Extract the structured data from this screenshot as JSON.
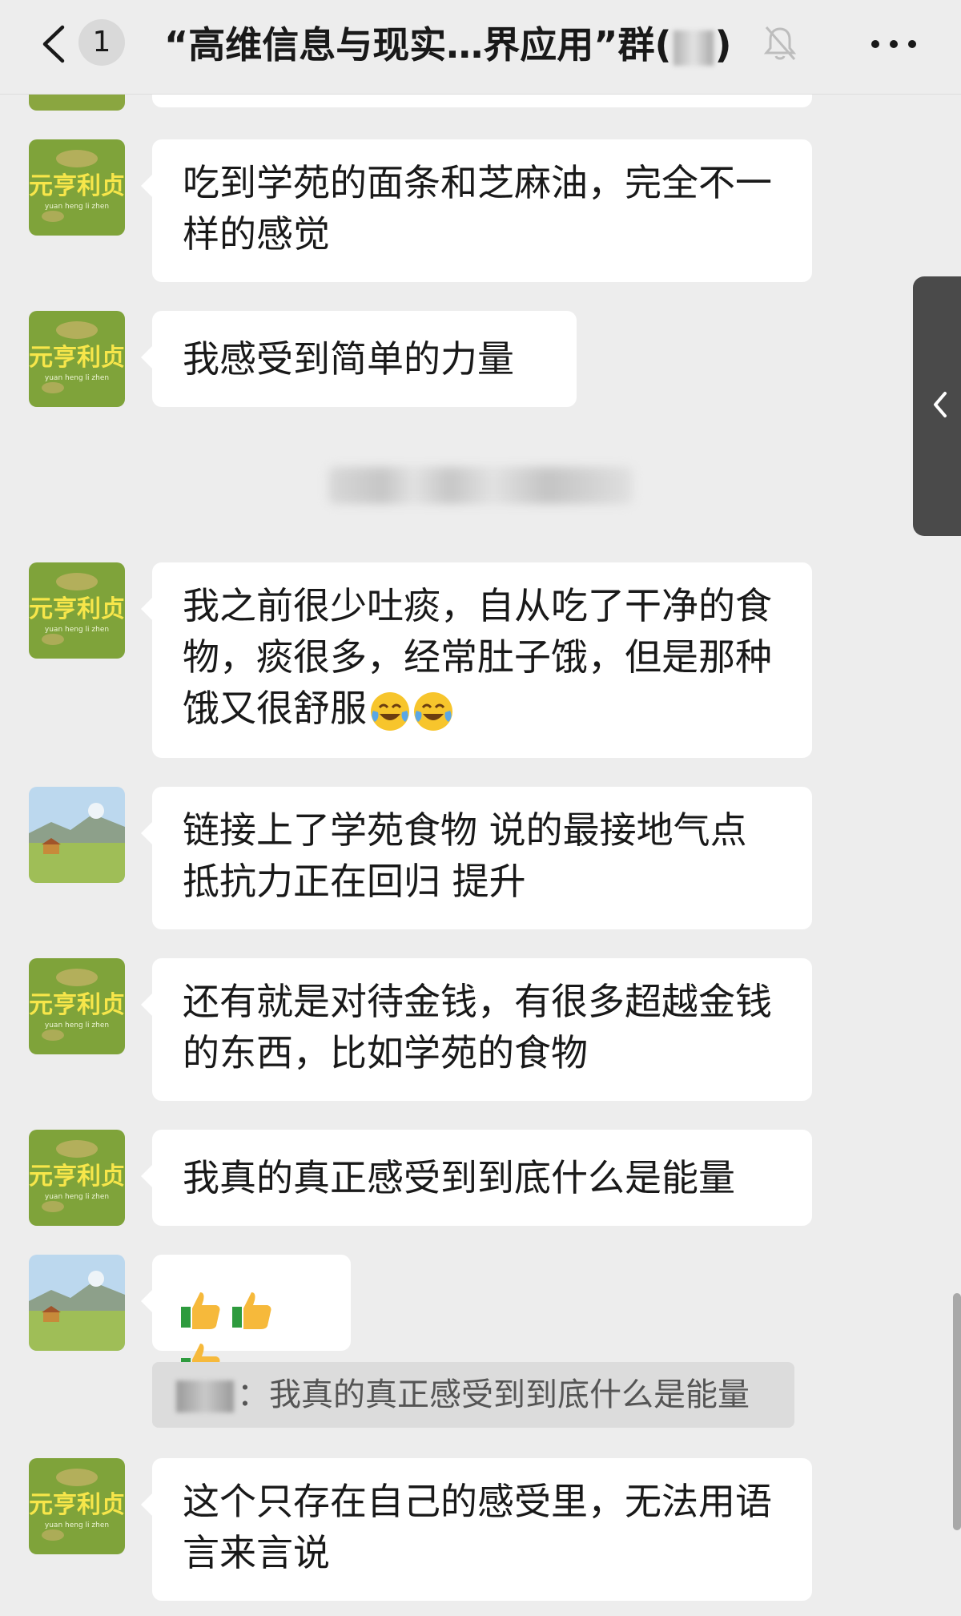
{
  "header": {
    "unread_count": "1",
    "title_prefix": "“高维信息与现实…界应用”群(",
    "title_suffix": ")"
  },
  "messages": [
    {
      "avatar": "logo",
      "text": "吃到学苑的面条和芝麻油，完全不一样的感觉"
    },
    {
      "avatar": "logo",
      "text": "我感受到简单的力量"
    },
    {
      "avatar": "logo",
      "text": "我之前很少吐痰，自从吃了干净的食物，痰很多，经常肚子饿，但是那种饿又很舒服"
    },
    {
      "avatar": "landscape",
      "text": "链接上了学苑食物 说的最接地气点 抵抗力正在回归 提升"
    },
    {
      "avatar": "logo",
      "text": "还有就是对待金钱，有很多超越金钱的东西，比如学苑的食物"
    },
    {
      "avatar": "logo",
      "text": "我真的真正感受到到底什么是能量"
    },
    {
      "avatar": "landscape",
      "text": ""
    },
    {
      "avatar": "logo",
      "text": "这个只存在自己的感受里，无法用语言来言说"
    }
  ],
  "quote": {
    "separator": "：",
    "text": "我真的真正感受到到底什么是能量"
  },
  "icons": {
    "back": "chevron-left-icon",
    "mute": "bell-off-icon",
    "more": "more-dots-icon",
    "laugh_cry": "face-tears-of-joy-icon",
    "thumbs_up": "thumbs-up-icon",
    "side_handle": "chevron-left-icon"
  },
  "colors": {
    "background": "#ededed",
    "bubble": "#ffffff",
    "quote_bg": "#dcdcdc",
    "side_handle": "#4a4a4a",
    "avatar_logo_green": "#7fa33a"
  }
}
